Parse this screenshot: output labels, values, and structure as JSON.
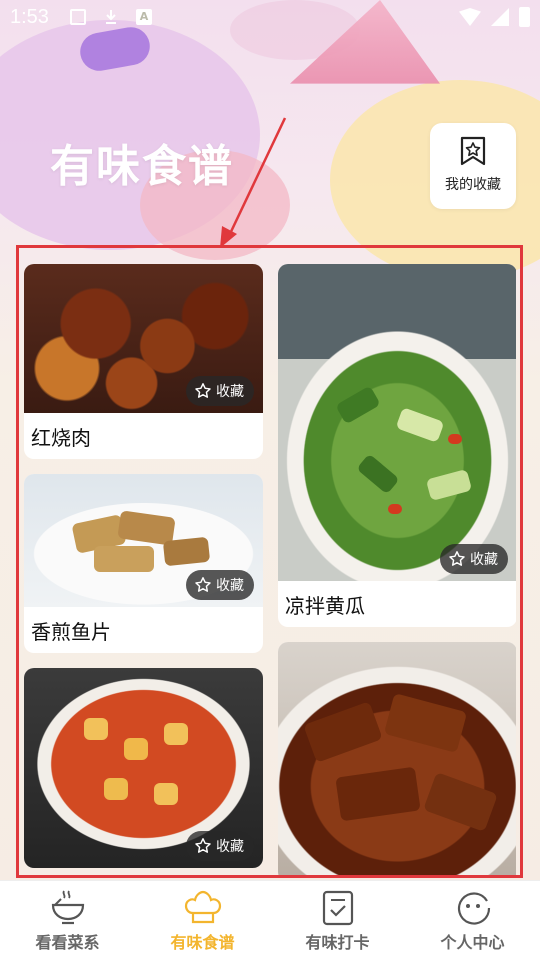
{
  "status_bar": {
    "time": "1:53"
  },
  "header": {
    "title": "有味食谱",
    "favorites_button": "我的收藏"
  },
  "recipes": {
    "left": [
      {
        "name": "红烧肉",
        "badge": "收藏"
      },
      {
        "name": "香煎鱼片",
        "badge": "收藏"
      },
      {
        "name": "",
        "badge": "收藏"
      }
    ],
    "right": [
      {
        "name": "凉拌黄瓜",
        "badge": "收藏"
      },
      {
        "name": "",
        "badge": ""
      }
    ]
  },
  "tabs": [
    {
      "label": "看看菜系",
      "icon": "bowl-icon",
      "active": false
    },
    {
      "label": "有味食谱",
      "icon": "chef-hat-icon",
      "active": true
    },
    {
      "label": "有味打卡",
      "icon": "checklist-icon",
      "active": false
    },
    {
      "label": "个人中心",
      "icon": "face-icon",
      "active": false
    }
  ],
  "colors": {
    "accent": "#f3b52e",
    "highlight": "#e0383c",
    "inactive_tab": "#666666"
  }
}
